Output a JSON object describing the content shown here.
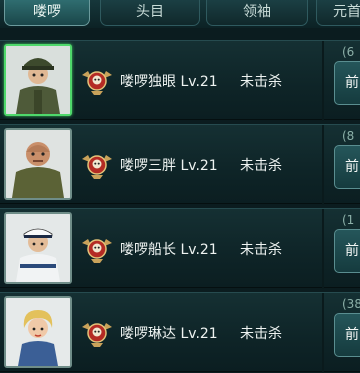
{
  "tabs": [
    {
      "label": "喽啰",
      "active": true
    },
    {
      "label": "头目",
      "active": false
    },
    {
      "label": "领袖",
      "active": false
    },
    {
      "label": "元首",
      "active": false
    }
  ],
  "rows": [
    {
      "name": "喽啰独眼 Lv.21",
      "status": "未击杀",
      "count": "(6",
      "action": "前",
      "portrait_icon": "officer-portrait-icon",
      "selected": true
    },
    {
      "name": "喽啰三胖 Lv.21",
      "status": "未击杀",
      "count": "(8",
      "action": "前",
      "portrait_icon": "bald-soldier-portrait-icon",
      "selected": false
    },
    {
      "name": "喽啰船长 Lv.21",
      "status": "未击杀",
      "count": "(1",
      "action": "前",
      "portrait_icon": "captain-portrait-icon",
      "selected": false
    },
    {
      "name": "喽啰琳达 Lv.21",
      "status": "未击杀",
      "count": "(38",
      "action": "前",
      "portrait_icon": "linda-portrait-icon",
      "selected": false
    }
  ],
  "emblem_icon": "winged-skull-emblem-icon"
}
